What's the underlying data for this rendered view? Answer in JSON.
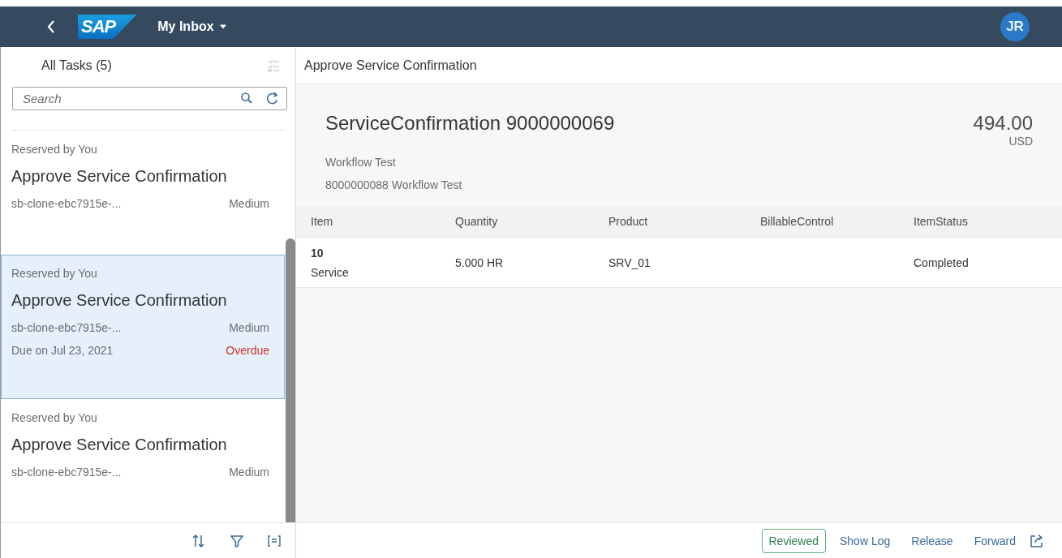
{
  "shell": {
    "logo": "SAP",
    "title": "My Inbox",
    "avatar": "JR"
  },
  "master": {
    "title": "All Tasks (5)",
    "search": {
      "placeholder": "Search"
    },
    "items": [
      {
        "status": "Reserved by You",
        "title": "Approve Service Confirmation",
        "id": "sb-clone-ebc7915e-...",
        "priority": "Medium",
        "selected": false
      },
      {
        "status": "Reserved by You",
        "title": "Approve Service Confirmation",
        "id": "sb-clone-ebc7915e-...",
        "priority": "Medium",
        "due": "Due on Jul 23, 2021",
        "due_status": {
          "text": "Overdue",
          "color": "#d0312d"
        },
        "selected": true
      },
      {
        "status": "Reserved by You",
        "title": "Approve Service Confirmation",
        "id": "sb-clone-ebc7915e-...",
        "priority": "Medium",
        "selected": false
      }
    ]
  },
  "detail": {
    "title": "Approve Service Confirmation",
    "object_title": "ServiceConfirmation 9000000069",
    "amount": "494.00",
    "currency": "USD",
    "attributes": [
      "Workflow Test",
      "8000000088 Workflow Test"
    ],
    "table": {
      "columns": [
        "Item",
        "Quantity",
        "Product",
        "BillableControl",
        "ItemStatus"
      ],
      "rows": [
        {
          "item": "10",
          "item_description": "Service",
          "quantity": "5.000 HR",
          "product": "SRV_01",
          "item_status": "Completed"
        }
      ]
    }
  },
  "footer": {
    "buttons": [
      {
        "label": "Reviewed",
        "kind": "accept"
      },
      {
        "label": "Show Log",
        "kind": "transparent"
      },
      {
        "label": "Release",
        "kind": "transparent"
      },
      {
        "label": "Forward",
        "kind": "transparent"
      }
    ]
  }
}
